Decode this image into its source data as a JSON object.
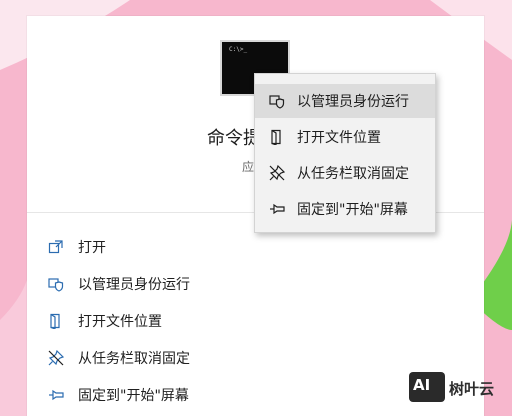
{
  "app": {
    "title": "命令提示符",
    "subtitle": "应用",
    "console_text": "C:\\>_"
  },
  "menu": {
    "items": [
      {
        "label": "打开",
        "icon": "open-icon"
      },
      {
        "label": "以管理员身份运行",
        "icon": "shield-icon"
      },
      {
        "label": "打开文件位置",
        "icon": "folder-location-icon"
      },
      {
        "label": "从任务栏取消固定",
        "icon": "unpin-icon"
      },
      {
        "label": "固定到\"开始\"屏幕",
        "icon": "pin-icon"
      }
    ]
  },
  "context_menu": {
    "items": [
      {
        "label": "以管理员身份运行",
        "icon": "shield-icon",
        "highlighted": true
      },
      {
        "label": "打开文件位置",
        "icon": "folder-location-icon"
      },
      {
        "label": "从任务栏取消固定",
        "icon": "unpin-icon"
      },
      {
        "label": "固定到\"开始\"屏幕",
        "icon": "pin-icon"
      }
    ]
  },
  "watermark": {
    "badge": "AI",
    "text": "树叶云"
  },
  "colors": {
    "background": "#f7b7cd",
    "accent_icon": "#2b6cb0",
    "menu_bg": "#f2f2f2",
    "highlight": "#dcdcdc"
  }
}
